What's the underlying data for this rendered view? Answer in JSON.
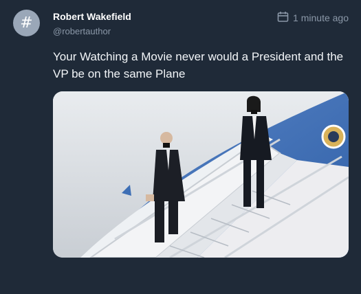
{
  "avatar": {
    "glyph": "#"
  },
  "author": {
    "name": "Robert Wakefield",
    "handle": "@robertauthor"
  },
  "timestamp": {
    "label": "1 minute ago"
  },
  "post": {
    "text": "Your Watching a Movie never would a President and the VP be on the same Plane"
  },
  "media": {
    "subject": "photo-two-people-descending-airplane-stairs"
  }
}
